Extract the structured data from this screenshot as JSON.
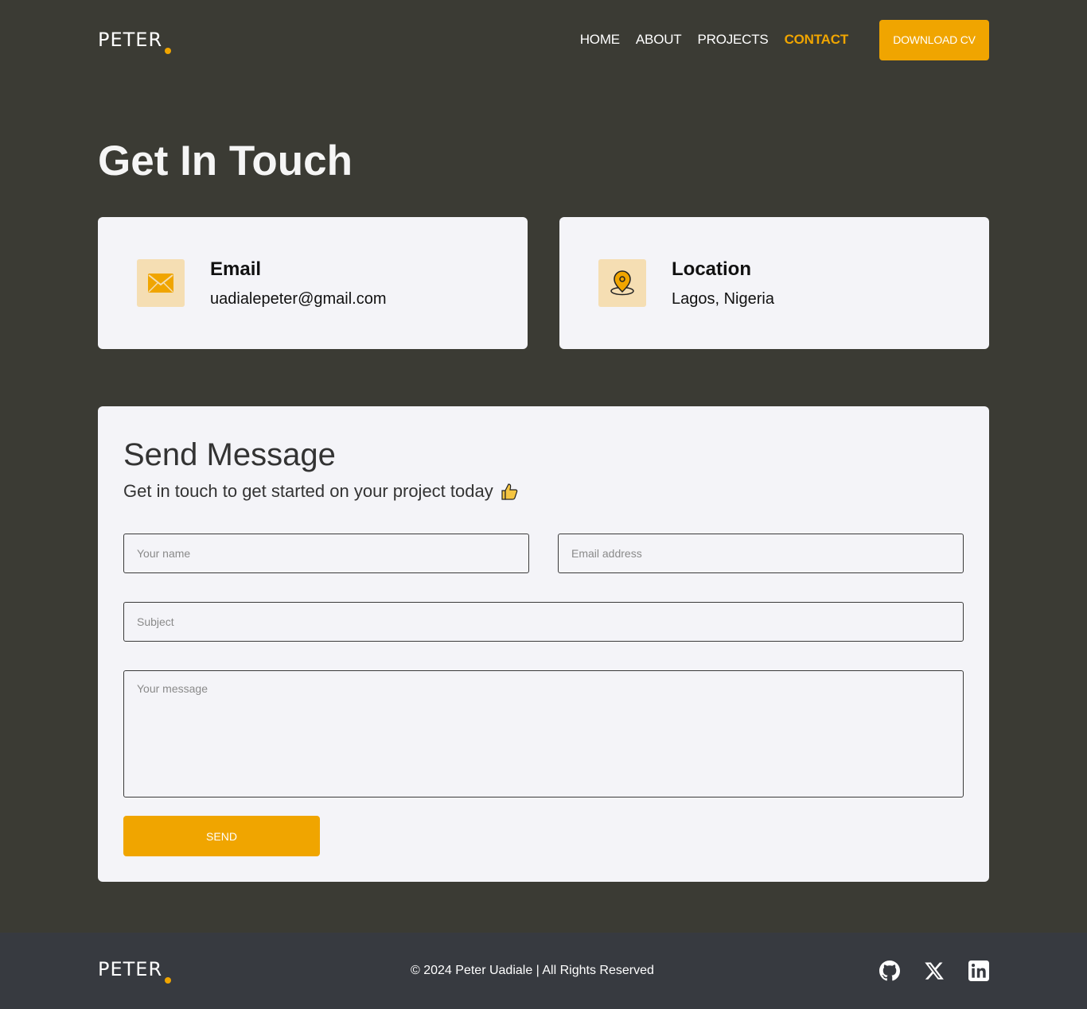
{
  "header": {
    "logo_text": "PETER",
    "nav": [
      {
        "label": "HOME"
      },
      {
        "label": "ABOUT"
      },
      {
        "label": "PROJECTS"
      },
      {
        "label": "CONTACT"
      }
    ],
    "download_cv_label": "DOWNLOAD CV"
  },
  "page_title": "Get In Touch",
  "info_cards": {
    "email": {
      "title": "Email",
      "value": "uadialepeter@gmail.com",
      "icon": "envelope-icon"
    },
    "location": {
      "title": "Location",
      "value": "Lagos, Nigeria",
      "icon": "map-pin-icon"
    }
  },
  "form": {
    "title": "Send Message",
    "subtitle": "Get in touch to get started on your project today",
    "subtitle_icon": "thumbs-up-icon",
    "name_placeholder": "Your name",
    "email_placeholder": "Email address",
    "subject_placeholder": "Subject",
    "message_placeholder": "Your message",
    "send_label": "SEND"
  },
  "footer": {
    "logo_text": "PETER",
    "copyright": "© 2024 Peter Uadiale | All Rights Reserved",
    "socials": [
      "github-icon",
      "x-icon",
      "linkedin-icon"
    ]
  },
  "colors": {
    "background": "#3b3b34",
    "accent": "#f0a500",
    "card": "#f4f4f8",
    "footer": "#373a40",
    "icon_bg": "#f5deb3"
  }
}
